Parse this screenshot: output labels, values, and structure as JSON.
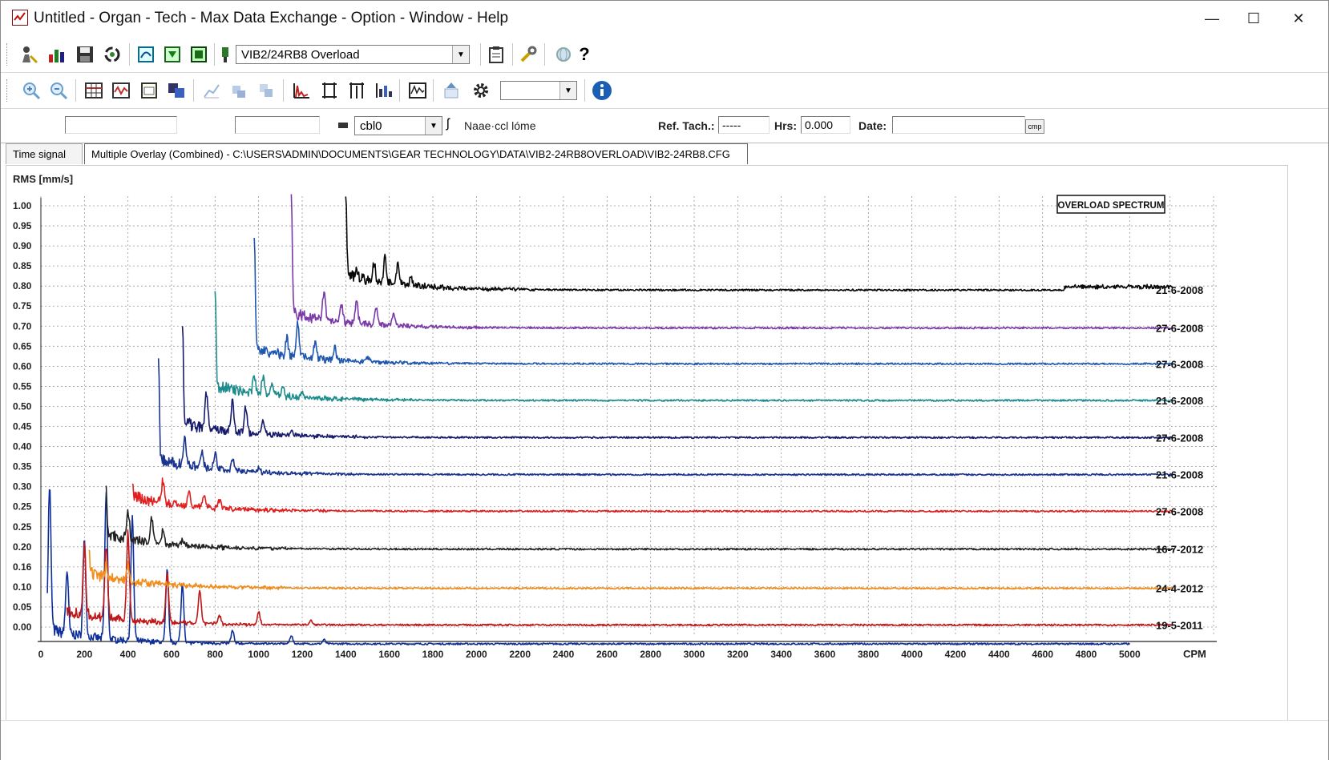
{
  "window": {
    "title": "Untitled - Organ - Tech - Max Data Exchange - Option - Window - Help",
    "minimize_label": "—",
    "maximize_label": "☐",
    "close_label": "✕"
  },
  "toolbar1": {
    "sensor_combo_value": "VIB2/24RB8  Overload",
    "help_label": "?"
  },
  "toolbar2": {
    "combo_value": ""
  },
  "infobar": {
    "field1_value": "",
    "field2_value": "",
    "unit_combo_value": "cbl0",
    "name_label": "Naae·ccl lóme",
    "ref_tach_label": "Ref. Tach.:",
    "ref_tach_value": "-----",
    "hrs_label": "Hrs:",
    "hrs_value": "0.000",
    "date_label": "Date:",
    "date_value": "",
    "date_btn_label": "cmp"
  },
  "tabs": [
    {
      "label": "Time signal",
      "active": false
    },
    {
      "label": "Multiple Overlay (Combined) - C:\\USERS\\ADMIN\\DOCUMENTS\\GEAR TECHNOLOGY\\DATA\\VIB2-24RB8OVERLOAD\\VIB2-24RB8.CFG",
      "active": true
    }
  ],
  "icons": {
    "toolbar1": [
      "user-probe-icon",
      "bar-chart-icon",
      "save-icon",
      "sync-icon",
      "route-icon",
      "download-icon",
      "upload-icon",
      "sensor-icon",
      "clipboard-icon",
      "wrench-icon",
      "globe-icon",
      "help-icon"
    ],
    "toolbar2": [
      "zoom-in-icon",
      "zoom-out-icon",
      "grid-table-icon",
      "waveform-icon",
      "report-icon",
      "multi-window-icon",
      "trend-icon",
      "trend-stack-icon",
      "copy-icon",
      "spectrum-icon",
      "cursor-icon",
      "harmonic-cursor-icon",
      "band-icon",
      "overlay-icon",
      "export-icon",
      "settings-gear-icon",
      "info-icon"
    ]
  },
  "chart_data": {
    "type": "line",
    "ylabel": "RMS [mm/s]",
    "xlabel": "CPM",
    "annotation": "OVERLOAD SPECTRUM",
    "yticks": [
      "1.00",
      "0.95",
      "0.90",
      "0.85",
      "0.80",
      "0.75",
      "0.70",
      "0.65",
      "0.60",
      "0.55",
      "0.50",
      "0.45",
      "0.40",
      "0.35",
      "0.30",
      "0.25",
      "0.25",
      "0.20",
      "0.16",
      "0.10",
      "0.05",
      "0.00"
    ],
    "xticks": [
      0,
      200,
      400,
      600,
      800,
      1000,
      1200,
      1400,
      1600,
      1800,
      2000,
      2200,
      2400,
      2600,
      2800,
      3000,
      3200,
      3400,
      3600,
      3800,
      4000,
      4200,
      4400,
      4600,
      4800,
      5000
    ],
    "xlim": [
      0,
      5400
    ],
    "grid": true,
    "series": [
      {
        "name": "21-6-2008",
        "color": "#0a0a0a",
        "x_start": 1400,
        "x_end": 5200,
        "baseline": 0.8,
        "peaks": [
          [
            1400,
            0.2
          ],
          [
            1450,
            0.02
          ],
          [
            1530,
            0.04
          ],
          [
            1580,
            0.06
          ],
          [
            1640,
            0.05
          ],
          [
            1700,
            0.02
          ]
        ],
        "end_bump": 0.008
      },
      {
        "name": "27-6-2008",
        "color": "#7a3aa8",
        "x_start": 1150,
        "x_end": 5200,
        "baseline": 0.71,
        "peaks": [
          [
            1150,
            0.29
          ],
          [
            1300,
            0.06
          ],
          [
            1380,
            0.04
          ],
          [
            1450,
            0.05
          ],
          [
            1540,
            0.04
          ],
          [
            1620,
            0.03
          ]
        ]
      },
      {
        "name": "27-6-2008",
        "color": "#1f57b0",
        "x_start": 980,
        "x_end": 5200,
        "baseline": 0.625,
        "peaks": [
          [
            980,
            0.27
          ],
          [
            1130,
            0.04
          ],
          [
            1180,
            0.08
          ],
          [
            1260,
            0.04
          ],
          [
            1350,
            0.03
          ],
          [
            1500,
            0.01
          ]
        ]
      },
      {
        "name": "21-6-2008",
        "color": "#1e8c8c",
        "x_start": 800,
        "x_end": 5200,
        "baseline": 0.538,
        "peaks": [
          [
            800,
            0.23
          ],
          [
            980,
            0.04
          ],
          [
            1020,
            0.04
          ],
          [
            1060,
            0.03
          ],
          [
            1110,
            0.02
          ],
          [
            1200,
            0.01
          ]
        ]
      },
      {
        "name": "27-6-2008",
        "color": "#161a6a",
        "x_start": 650,
        "x_end": 5200,
        "baseline": 0.45,
        "peaks": [
          [
            650,
            0.24
          ],
          [
            760,
            0.08
          ],
          [
            880,
            0.07
          ],
          [
            940,
            0.06
          ],
          [
            1020,
            0.03
          ],
          [
            1150,
            0.01
          ]
        ]
      },
      {
        "name": "21-6-2008",
        "color": "#1a3590",
        "x_start": 540,
        "x_end": 5200,
        "baseline": 0.362,
        "peaks": [
          [
            540,
            0.23
          ],
          [
            660,
            0.07
          ],
          [
            740,
            0.04
          ],
          [
            800,
            0.04
          ],
          [
            880,
            0.03
          ],
          [
            1000,
            0.01
          ]
        ]
      },
      {
        "name": "27-6-2008",
        "color": "#e02020",
        "x_start": 420,
        "x_end": 5200,
        "baseline": 0.275,
        "peaks": [
          [
            420,
            0.02
          ],
          [
            560,
            0.05
          ],
          [
            680,
            0.04
          ],
          [
            750,
            0.03
          ],
          [
            820,
            0.02
          ]
        ]
      },
      {
        "name": "16-7-2012",
        "color": "#222222",
        "x_start": 300,
        "x_end": 5200,
        "baseline": 0.185,
        "peaks": [
          [
            300,
            0.1
          ],
          [
            400,
            0.07
          ],
          [
            510,
            0.06
          ],
          [
            560,
            0.03
          ],
          [
            650,
            0.01
          ]
        ]
      },
      {
        "name": "24-4-2012",
        "color": "#f08c1a",
        "x_start": 220,
        "x_end": 5200,
        "baseline": 0.092,
        "peaks": [
          [
            220,
            0.05
          ],
          [
            300,
            0.03
          ],
          [
            400,
            0.04
          ]
        ]
      },
      {
        "name": "19-5-2011",
        "color": "#c01818",
        "x_start": 120,
        "x_end": 5200,
        "baseline": 0.005,
        "peaks": [
          [
            200,
            0.16
          ],
          [
            300,
            0.17
          ],
          [
            400,
            0.21
          ],
          [
            580,
            0.12
          ],
          [
            730,
            0.08
          ],
          [
            820,
            0.02
          ],
          [
            1000,
            0.03
          ],
          [
            1240,
            0.01
          ]
        ]
      },
      {
        "name": "",
        "color": "#0f2f9a",
        "x_start": 30,
        "x_end": 5000,
        "baseline": -0.04,
        "peaks": [
          [
            40,
            0.34
          ],
          [
            120,
            0.15
          ],
          [
            200,
            0.23
          ],
          [
            300,
            0.35
          ],
          [
            420,
            0.29
          ],
          [
            580,
            0.17
          ],
          [
            650,
            0.14
          ],
          [
            880,
            0.03
          ],
          [
            1150,
            0.02
          ],
          [
            1300,
            0.01
          ]
        ]
      }
    ]
  }
}
